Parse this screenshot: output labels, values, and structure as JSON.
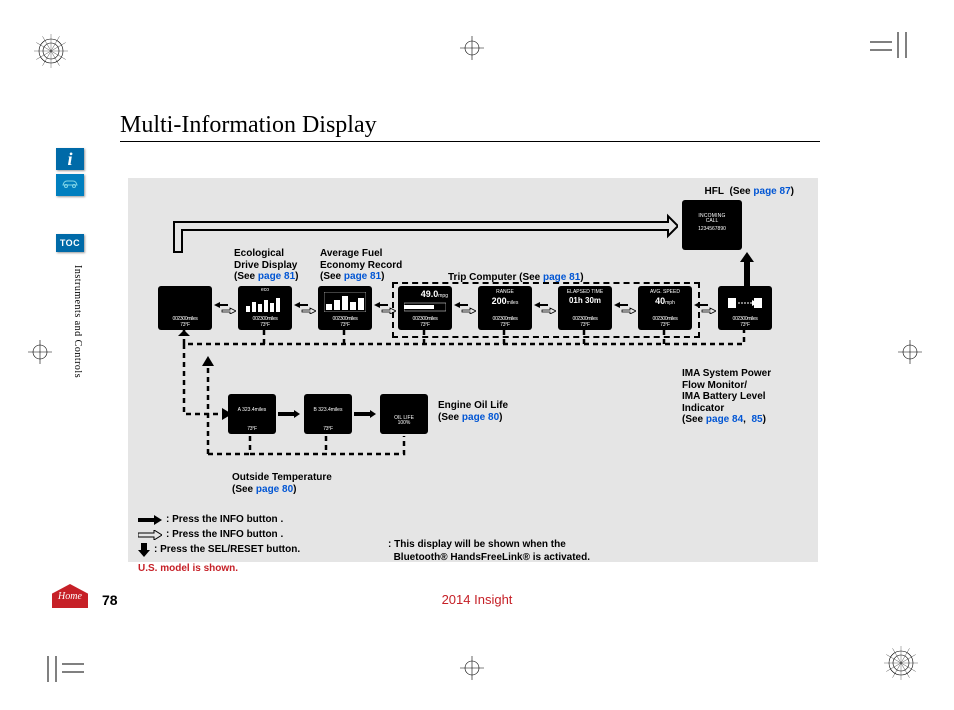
{
  "page": {
    "title": "Multi-Information Display",
    "section_vertical": "Instruments and Controls",
    "page_number": "78",
    "vehicle": "2014 Insight"
  },
  "sidetabs": {
    "info_glyph": "i",
    "toc_label": "TOC",
    "home_label": "Home"
  },
  "labels": {
    "hfl": "HFL",
    "hfl_see": "(See ",
    "hfl_page": "page 87",
    "trip_computer": "Trip Computer (See ",
    "trip_page": "page 81",
    "eco": "Ecological\nDrive Display\n(See ",
    "eco_page": "page 81",
    "avg": "Average Fuel\nEconomy Record\n(See ",
    "avg_page": "page 81",
    "oil": "Engine Oil Life\n(See ",
    "oil_page": "page 80",
    "outside": "Outside Temperature\n(See ",
    "outside_page": "page 80",
    "ima": "IMA System Power\nFlow Monitor/\nIMA Battery Level\nIndicator\n(See ",
    "ima_page1": "page 84",
    "ima_page2": "85",
    "close_paren": ")"
  },
  "tiles": {
    "odo_common": "002300miles",
    "temp_common": "73°F",
    "hfl_line1": "INCOMING",
    "hfl_line2": "CALL",
    "hfl_line3": "1234567890",
    "mpg_big": "49.0",
    "mpg_unit": "mpg",
    "range_lbl": "RANGE",
    "range_val": "200",
    "range_unit": "miles",
    "elapsed_lbl": "ELAPSED TIME",
    "elapsed_val": "01h 30m",
    "avgspd_lbl": "AVG. SPEED",
    "avgspd_val": "40",
    "avgspd_unit": "mph",
    "eco_lbl": "eco",
    "oil_lbl": "OIL LIFE",
    "oil_val": "100%",
    "tripA": "A   323.4miles",
    "tripB": "B   323.4miles"
  },
  "legend": {
    "info_filled": ": Press the INFO button    .",
    "info_outline": ": Press the INFO button    .",
    "sel_down": ": Press the SEL/RESET button.",
    "us_note": "U.S. model is shown.",
    "bt_note1": ": This display will be shown when the",
    "bt_note2": "Bluetooth® HandsFreeLink® is activated."
  }
}
